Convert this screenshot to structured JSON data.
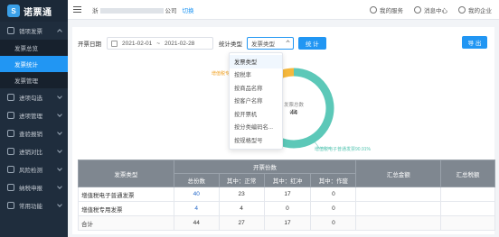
{
  "brand": {
    "name": "诺票通",
    "mark": "S"
  },
  "sidebar": {
    "items": [
      {
        "label": "销项发票",
        "open": true
      },
      {
        "label": "发票总览",
        "sub": true
      },
      {
        "label": "发票统计",
        "sub": true,
        "active": true
      },
      {
        "label": "发票管理",
        "sub": true
      },
      {
        "label": "进项勾选"
      },
      {
        "label": "进项管理"
      },
      {
        "label": "查验报销"
      },
      {
        "label": "进销对比"
      },
      {
        "label": "风险检测"
      },
      {
        "label": "纳税申报"
      },
      {
        "label": "常用功能"
      }
    ]
  },
  "topbar": {
    "company_prefix": "浙",
    "company_suffix": "公司",
    "switch_label": "切换",
    "service_label": "我的服务",
    "message_label": "消息中心",
    "enterprise_label": "我的企业"
  },
  "filters": {
    "date_label": "开票日期",
    "date_start": "2021-02-01",
    "date_sep": "~",
    "date_end": "2021-02-28",
    "stat_type_label": "统计类型",
    "stat_type_value": "发票类型",
    "stat_button": "统 计",
    "export_button": "导 出"
  },
  "dropdown": {
    "options": [
      "发票类型",
      "按税率",
      "按商品名称",
      "按客户名称",
      "按开票机",
      "按分类编码名...",
      "按规格型号"
    ],
    "selected_index": 0
  },
  "chart_data": {
    "type": "pie",
    "center_label": "发票总数(张)",
    "center_value": 44,
    "slices": [
      {
        "name": "增值税普通发票",
        "value": 90.91,
        "color": "#5cc8b8"
      },
      {
        "name": "增值税专用发票",
        "value": 9.09,
        "color": "#f5b83d"
      }
    ],
    "annotation_bottom": "增值税电子普通发票90.91%",
    "annotation_top": "增值税专用发票"
  },
  "table": {
    "headers": {
      "type": "发票类型",
      "count_group": "开票份数",
      "total": "总份数",
      "normal": "其中：正常",
      "red": "其中：红冲",
      "void": "其中：作废",
      "amount": "汇总金额",
      "tax": "汇总税额"
    },
    "rows": [
      {
        "type": "增值税电子普通发票",
        "total": "40",
        "normal": "23",
        "red": "17",
        "void": "0",
        "amount": "",
        "tax": ""
      },
      {
        "type": "增值税专用发票",
        "total": "4",
        "normal": "4",
        "red": "0",
        "void": "0",
        "amount": "",
        "tax": ""
      },
      {
        "type": "合计",
        "total": "44",
        "normal": "27",
        "red": "17",
        "void": "0",
        "amount": "",
        "tax": ""
      }
    ]
  }
}
